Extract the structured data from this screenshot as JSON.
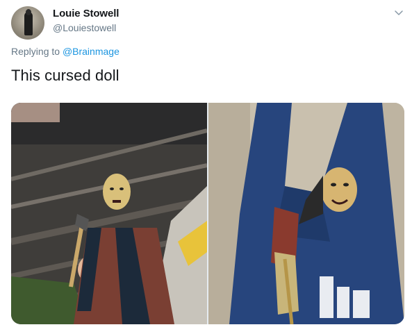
{
  "tweet": {
    "author": {
      "display_name": "Louie Stowell",
      "handle": "@Louiestowell"
    },
    "reply": {
      "prefix": "Replying to",
      "target": "@Brainmage"
    },
    "text": "This cursed doll",
    "media_count": 2
  },
  "icons": {
    "menu": "chevron-down-icon"
  },
  "colors": {
    "text_primary": "#14171a",
    "text_secondary": "#657786",
    "link": "#1b95e0"
  }
}
